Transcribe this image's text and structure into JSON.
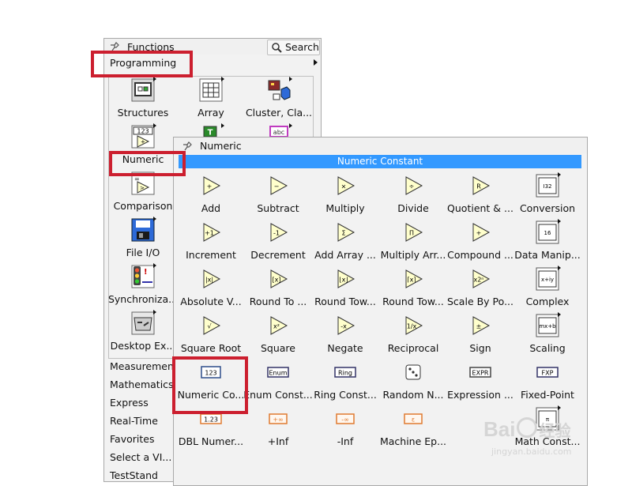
{
  "functions_palette": {
    "title": "Functions",
    "search_label": "Search",
    "category": "Programming",
    "items": [
      {
        "label": "Structures",
        "icon": "structures-icon"
      },
      {
        "label": "Array",
        "icon": "array-icon"
      },
      {
        "label": "Cluster, Cla...",
        "icon": "cluster-icon"
      },
      {
        "label": "Numeric",
        "icon": "numeric-icon"
      },
      {
        "label": "Comparison",
        "icon": "comparison-icon"
      },
      {
        "label": "File I/O",
        "icon": "file-io-icon"
      },
      {
        "label": "Synchroniza...",
        "icon": "synchronization-icon"
      },
      {
        "label": "Desktop Ex...",
        "icon": "desktop-execution-icon"
      }
    ],
    "partial_icon_labels": [
      "T",
      "abc"
    ],
    "categories": [
      "Measurement...",
      "Mathematics",
      "Express",
      "Real-Time",
      "Favorites",
      "Select a VI...",
      "TestStand"
    ]
  },
  "numeric_palette": {
    "title": "Numeric",
    "tooltip": "Numeric Constant",
    "items": [
      {
        "label": "Add",
        "glyph": "+"
      },
      {
        "label": "Subtract",
        "glyph": "−"
      },
      {
        "label": "Multiply",
        "glyph": "×"
      },
      {
        "label": "Divide",
        "glyph": "÷"
      },
      {
        "label": "Quotient & ...",
        "glyph": "R"
      },
      {
        "label": "Conversion",
        "glyph": "I32"
      },
      {
        "label": "Increment",
        "glyph": "+1"
      },
      {
        "label": "Decrement",
        "glyph": "-1"
      },
      {
        "label": "Add Array ...",
        "glyph": "Σ"
      },
      {
        "label": "Multiply Arr...",
        "glyph": "Π"
      },
      {
        "label": "Compound ...",
        "glyph": "+"
      },
      {
        "label": "Data Manip...",
        "glyph": "16"
      },
      {
        "label": "Absolute V...",
        "glyph": "|x|"
      },
      {
        "label": "Round To ...",
        "glyph": "[x]"
      },
      {
        "label": "Round Tow...",
        "glyph": "⌊x⌋"
      },
      {
        "label": "Round Tow...",
        "glyph": "⌈x⌉"
      },
      {
        "label": "Scale By Po...",
        "glyph": "x2ⁿ"
      },
      {
        "label": "Complex",
        "glyph": "x+iy"
      },
      {
        "label": "Square Root",
        "glyph": "√"
      },
      {
        "label": "Square",
        "glyph": "x²"
      },
      {
        "label": "Negate",
        "glyph": "-x"
      },
      {
        "label": "Reciprocal",
        "glyph": "1/x"
      },
      {
        "label": "Sign",
        "glyph": "±"
      },
      {
        "label": "Scaling",
        "glyph": "mx+b"
      },
      {
        "label": "Numeric Co...",
        "glyph": "123"
      },
      {
        "label": "Enum Const...",
        "glyph": "Enum"
      },
      {
        "label": "Ring Const...",
        "glyph": "Ring"
      },
      {
        "label": "Random N...",
        "glyph": "⚄"
      },
      {
        "label": "Expression ...",
        "glyph": "EXPR"
      },
      {
        "label": "Fixed-Point",
        "glyph": "FXP"
      },
      {
        "label": "DBL Numer...",
        "glyph": "1.23"
      },
      {
        "label": "+Inf",
        "glyph": "+∞"
      },
      {
        "label": "-Inf",
        "glyph": "-∞"
      },
      {
        "label": "Machine Ep...",
        "glyph": "ε"
      },
      {
        "label": "",
        "glyph": ""
      },
      {
        "label": "Math Const...",
        "glyph": "π"
      }
    ]
  },
  "watermark": {
    "logo": "Bai",
    "logo_suffix": "经验",
    "url": "jingyan.baidu.com"
  },
  "colors": {
    "highlight": "#cc1f2f",
    "tooltip": "#3399ff"
  }
}
